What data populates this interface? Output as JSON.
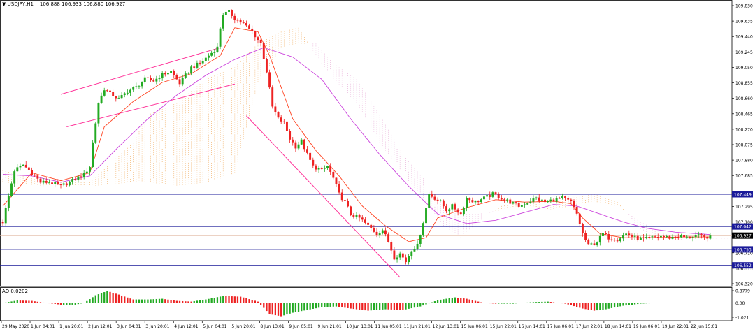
{
  "header": {
    "symbol_label": "USDJPY,H1",
    "ohlc": "106.888 106.933 106.880 106.927",
    "indicator_label": "AO 0.0202"
  },
  "colors": {
    "bull": "#22aa22",
    "bear": "#ee2222",
    "fast_ma": "#ff4422",
    "slow_ma": "#cc44dd",
    "channel": "#ff3399",
    "hline": "#1a1a99",
    "cloud_bull": "#f2b066",
    "cloud_bear": "#e8b0d8",
    "label_bg": "#1a1a99",
    "price_bg": "#000000",
    "ao_up": "#22aa22",
    "ao_down": "#ee2222"
  },
  "chart_data": {
    "type": "candlestick",
    "symbol": "USDJPY",
    "timeframe": "H1",
    "x_labels": [
      "29 May 2020",
      "1 Jun 04:01",
      "1 Jun 20:01",
      "2 Jun 12:01",
      "3 Jun 04:01",
      "3 Jun 20:01",
      "4 Jun 12:01",
      "5 Jun 04:01",
      "5 Jun 20:01",
      "8 Jun 13:01",
      "9 Jun 05:01",
      "9 Jun 21:01",
      "10 Jun 13:01",
      "11 Jun 05:01",
      "11 Jun 21:01",
      "12 Jun 13:01",
      "15 Jun 06:01",
      "15 Jun 22:01",
      "16 Jun 14:01",
      "17 Jun 06:01",
      "17 Jun 22:01",
      "18 Jun 14:01",
      "19 Jun 06:01",
      "19 Jun 22:01",
      "22 Jun 15:01"
    ],
    "y_ticks": [
      109.83,
      109.635,
      109.44,
      109.245,
      109.05,
      108.855,
      108.66,
      108.465,
      108.27,
      108.075,
      107.88,
      107.685,
      107.295,
      107.1,
      106.71,
      106.515,
      106.32
    ],
    "ylim": [
      106.32,
      109.83
    ],
    "last_price": "106.927",
    "horizontal_levels": [
      {
        "label": "107.449",
        "value": 107.449
      },
      {
        "label": "107.042",
        "value": 107.042
      },
      {
        "label": "106.753",
        "value": 106.753
      },
      {
        "label": "106.552",
        "value": 106.552
      }
    ],
    "trendlines": [
      {
        "x": [
          20,
          75
        ],
        "y": [
          108.71,
          109.3
        ]
      },
      {
        "x": [
          22,
          80
        ],
        "y": [
          108.3,
          108.84
        ]
      },
      {
        "x": [
          84,
          137
        ],
        "y": [
          108.44,
          106.4
        ]
      }
    ],
    "path": [
      [
        0,
        107.1
      ],
      [
        4,
        107.75
      ],
      [
        7,
        107.82
      ],
      [
        10,
        107.72
      ],
      [
        13,
        107.6
      ],
      [
        16,
        107.6
      ],
      [
        20,
        107.55
      ],
      [
        24,
        107.62
      ],
      [
        28,
        107.7
      ],
      [
        30,
        107.8
      ],
      [
        31,
        108.1
      ],
      [
        33,
        108.6
      ],
      [
        35,
        108.78
      ],
      [
        37,
        108.72
      ],
      [
        40,
        108.65
      ],
      [
        43,
        108.75
      ],
      [
        46,
        108.8
      ],
      [
        49,
        108.9
      ],
      [
        52,
        108.88
      ],
      [
        55,
        108.96
      ],
      [
        58,
        109.0
      ],
      [
        61,
        108.85
      ],
      [
        63,
        108.95
      ],
      [
        65,
        109.05
      ],
      [
        68,
        109.1
      ],
      [
        71,
        109.2
      ],
      [
        74,
        109.3
      ],
      [
        75,
        109.55
      ],
      [
        76,
        109.72
      ],
      [
        78,
        109.75
      ],
      [
        80,
        109.67
      ],
      [
        83,
        109.6
      ],
      [
        86,
        109.5
      ],
      [
        89,
        109.35
      ],
      [
        91,
        109.0
      ],
      [
        93,
        108.55
      ],
      [
        95,
        108.4
      ],
      [
        97,
        108.35
      ],
      [
        99,
        108.15
      ],
      [
        101,
        108.05
      ],
      [
        103,
        108.12
      ],
      [
        105,
        107.95
      ],
      [
        107,
        107.8
      ],
      [
        110,
        107.75
      ],
      [
        112,
        107.8
      ],
      [
        114,
        107.65
      ],
      [
        116,
        107.45
      ],
      [
        118,
        107.35
      ],
      [
        120,
        107.2
      ],
      [
        123,
        107.15
      ],
      [
        126,
        107.05
      ],
      [
        129,
        106.95
      ],
      [
        131,
        107.0
      ],
      [
        133,
        106.85
      ],
      [
        135,
        106.65
      ],
      [
        137,
        106.7
      ],
      [
        139,
        106.6
      ],
      [
        141,
        106.75
      ],
      [
        143,
        106.8
      ],
      [
        145,
        107.1
      ],
      [
        147,
        107.45
      ],
      [
        149,
        107.4
      ],
      [
        151,
        107.35
      ],
      [
        153,
        107.25
      ],
      [
        155,
        107.3
      ],
      [
        158,
        107.2
      ],
      [
        160,
        107.4
      ],
      [
        163,
        107.35
      ],
      [
        166,
        107.4
      ],
      [
        169,
        107.45
      ],
      [
        172,
        107.4
      ],
      [
        175,
        107.35
      ],
      [
        178,
        107.3
      ],
      [
        181,
        107.35
      ],
      [
        184,
        107.4
      ],
      [
        187,
        107.35
      ],
      [
        190,
        107.38
      ],
      [
        193,
        107.4
      ],
      [
        196,
        107.35
      ],
      [
        198,
        107.2
      ],
      [
        200,
        106.95
      ],
      [
        202,
        106.8
      ],
      [
        205,
        106.85
      ],
      [
        207,
        106.95
      ],
      [
        209,
        106.9
      ],
      [
        212,
        106.88
      ],
      [
        215,
        106.95
      ],
      [
        218,
        106.9
      ],
      [
        221,
        106.88
      ],
      [
        224,
        106.9
      ],
      [
        227,
        106.92
      ],
      [
        230,
        106.9
      ],
      [
        233,
        106.92
      ],
      [
        236,
        106.9
      ],
      [
        239,
        106.93
      ],
      [
        242,
        106.9
      ],
      [
        244,
        106.92
      ]
    ],
    "fast_ma": [
      [
        0,
        107.3
      ],
      [
        10,
        107.72
      ],
      [
        20,
        107.62
      ],
      [
        30,
        107.72
      ],
      [
        35,
        108.3
      ],
      [
        45,
        108.62
      ],
      [
        55,
        108.86
      ],
      [
        65,
        108.97
      ],
      [
        75,
        109.2
      ],
      [
        80,
        109.55
      ],
      [
        88,
        109.5
      ],
      [
        92,
        109.2
      ],
      [
        96,
        108.8
      ],
      [
        100,
        108.4
      ],
      [
        108,
        108.0
      ],
      [
        116,
        107.68
      ],
      [
        124,
        107.3
      ],
      [
        132,
        107.05
      ],
      [
        140,
        106.85
      ],
      [
        146,
        106.9
      ],
      [
        150,
        107.15
      ],
      [
        160,
        107.28
      ],
      [
        170,
        107.38
      ],
      [
        180,
        107.35
      ],
      [
        190,
        107.36
      ],
      [
        196,
        107.33
      ],
      [
        200,
        107.15
      ],
      [
        206,
        106.95
      ],
      [
        214,
        106.9
      ],
      [
        224,
        106.9
      ],
      [
        234,
        106.91
      ],
      [
        244,
        106.91
      ]
    ],
    "slow_ma": [
      [
        0,
        107.7
      ],
      [
        10,
        107.68
      ],
      [
        20,
        107.6
      ],
      [
        30,
        107.68
      ],
      [
        40,
        108.05
      ],
      [
        50,
        108.4
      ],
      [
        60,
        108.7
      ],
      [
        70,
        108.95
      ],
      [
        80,
        109.15
      ],
      [
        90,
        109.3
      ],
      [
        100,
        109.18
      ],
      [
        110,
        108.9
      ],
      [
        120,
        108.4
      ],
      [
        130,
        107.95
      ],
      [
        140,
        107.55
      ],
      [
        150,
        107.2
      ],
      [
        160,
        107.08
      ],
      [
        170,
        107.12
      ],
      [
        180,
        107.22
      ],
      [
        190,
        107.32
      ],
      [
        198,
        107.3
      ],
      [
        206,
        107.2
      ],
      [
        214,
        107.1
      ],
      [
        222,
        107.02
      ],
      [
        232,
        106.97
      ],
      [
        244,
        106.94
      ]
    ],
    "cloud": [
      [
        0,
        107.6,
        107.75
      ],
      [
        15,
        107.55,
        107.6
      ],
      [
        30,
        107.55,
        107.6
      ],
      [
        45,
        107.6,
        108.1
      ],
      [
        50,
        107.6,
        108.45
      ],
      [
        60,
        107.55,
        108.6
      ],
      [
        70,
        107.6,
        108.9
      ],
      [
        80,
        107.7,
        109.05
      ],
      [
        88,
        108.85,
        109.35
      ],
      [
        96,
        109.3,
        109.5
      ],
      [
        102,
        109.35,
        109.55
      ],
      [
        108,
        109.35,
        109.2
      ],
      [
        114,
        109.1,
        108.9
      ],
      [
        122,
        108.9,
        108.6
      ],
      [
        130,
        108.45,
        108.1
      ],
      [
        138,
        107.95,
        107.7
      ],
      [
        145,
        107.65,
        107.4
      ],
      [
        152,
        107.3,
        107.05
      ],
      [
        158,
        107.2,
        106.9
      ],
      [
        164,
        107.2,
        107.1
      ],
      [
        172,
        107.25,
        107.3
      ],
      [
        180,
        107.3,
        107.35
      ],
      [
        188,
        107.25,
        107.3
      ],
      [
        196,
        107.3,
        107.4
      ],
      [
        204,
        107.35,
        107.45
      ],
      [
        212,
        107.3,
        107.35
      ],
      [
        220,
        107.1,
        107.0
      ],
      [
        228,
        106.95,
        106.9
      ],
      [
        236,
        106.9,
        106.87
      ],
      [
        252,
        106.9,
        106.87
      ]
    ],
    "ao_label": "AO",
    "ao_value": "0.0202",
    "ao_ticks": [
      "0.8779",
      "0.00",
      "-1.021"
    ],
    "ao_ylim": [
      -1.021,
      0.8779
    ],
    "ao": [
      [
        0,
        0.0
      ],
      [
        5,
        0.18
      ],
      [
        10,
        0.15
      ],
      [
        15,
        0.0
      ],
      [
        20,
        -0.12
      ],
      [
        25,
        -0.12
      ],
      [
        28,
        0.0
      ],
      [
        32,
        0.55
      ],
      [
        36,
        0.85
      ],
      [
        40,
        0.6
      ],
      [
        45,
        0.25
      ],
      [
        50,
        0.25
      ],
      [
        55,
        0.3
      ],
      [
        60,
        0.15
      ],
      [
        65,
        0.1
      ],
      [
        70,
        0.25
      ],
      [
        76,
        0.5
      ],
      [
        82,
        0.45
      ],
      [
        88,
        0.1
      ],
      [
        92,
        -0.8
      ],
      [
        96,
        -0.95
      ],
      [
        100,
        -0.7
      ],
      [
        105,
        -0.5
      ],
      [
        110,
        -0.3
      ],
      [
        115,
        -0.25
      ],
      [
        120,
        -0.4
      ],
      [
        126,
        -0.55
      ],
      [
        132,
        -0.45
      ],
      [
        138,
        -0.5
      ],
      [
        144,
        -0.25
      ],
      [
        150,
        0.2
      ],
      [
        156,
        0.4
      ],
      [
        160,
        0.3
      ],
      [
        166,
        0.0
      ],
      [
        170,
        -0.05
      ],
      [
        176,
        -0.05
      ],
      [
        182,
        0.05
      ],
      [
        188,
        0.1
      ],
      [
        194,
        -0.05
      ],
      [
        200,
        -0.4
      ],
      [
        204,
        -0.55
      ],
      [
        208,
        -0.45
      ],
      [
        214,
        -0.2
      ],
      [
        220,
        -0.05
      ],
      [
        226,
        0.0
      ],
      [
        244,
        0.02
      ]
    ]
  }
}
